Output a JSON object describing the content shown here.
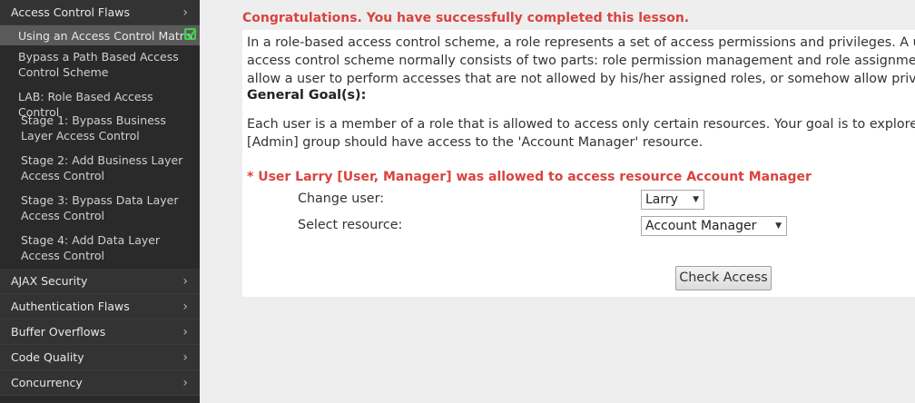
{
  "sidebar": {
    "category_top": "Access Control Flaws",
    "sub_items": [
      "Using an Access Control Matrix",
      "Bypass a Path Based Access Control Scheme",
      "LAB: Role Based Access Control",
      "Stage 1: Bypass Business Layer Access Control",
      "Stage 2: Add Business Layer Access Control",
      "Stage 3: Bypass Data Layer Access Control",
      "Stage 4: Add Data Layer Access Control"
    ],
    "categories": [
      "AJAX Security",
      "Authentication Flaws",
      "Buffer Overflows",
      "Code Quality",
      "Concurrency"
    ],
    "chevron": "›",
    "completed_icon": "check-icon"
  },
  "main": {
    "congrats": "Congratulations. You have successfully completed this lesson.",
    "intro_lines": [
      "In a role-based access control scheme, a role represents a set of access permissions and privileges. A user can",
      "access control scheme normally consists of two parts: role permission management and role assignment. A br",
      "allow a user to perform accesses that are not allowed by his/her assigned roles, or somehow allow privilege es"
    ],
    "goal_heading": "General Goal(s):",
    "goal_lines": [
      "Each user is a member of a role that is allowed to access only certain resources. Your goal is to explore the acc",
      "[Admin] group should have access to the 'Account Manager' resource."
    ],
    "result": "* User Larry [User, Manager] was allowed to access resource Account Manager",
    "change_user_label": "Change user:",
    "change_user_value": "Larry",
    "select_resource_label": "Select resource:",
    "select_resource_value": "Account Manager",
    "check_button": "Check Access",
    "accent_color": "#d9443f"
  }
}
